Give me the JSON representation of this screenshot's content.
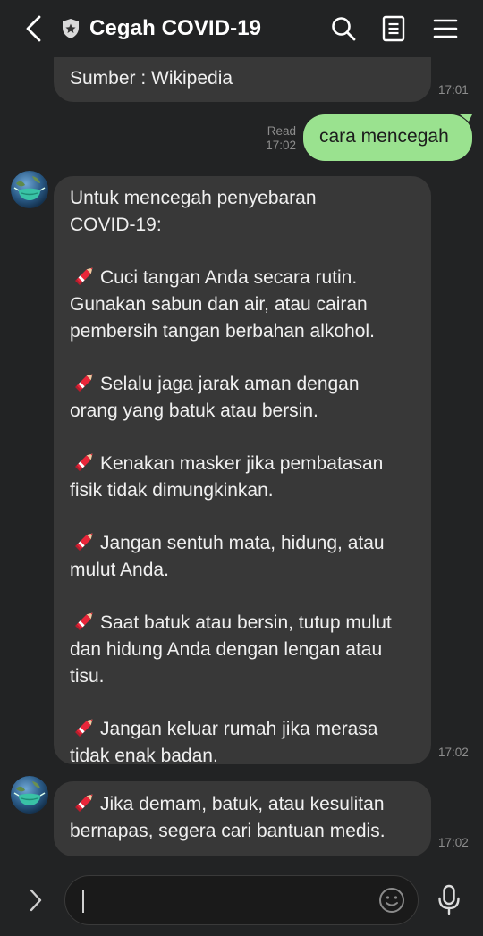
{
  "header": {
    "title": "Cegah COVID-19",
    "icons": [
      "back-chevron-icon",
      "shield-star-icon",
      "search-icon",
      "notes-icon",
      "menu-icon"
    ]
  },
  "messages": {
    "m1": {
      "text": "Sumber : Wikipedia",
      "time": "17:01"
    },
    "m2": {
      "text": "cara mencegah",
      "read_label": "Read",
      "time": "17:02"
    },
    "m3": {
      "intro_l1": "Untuk mencegah penyebaran",
      "intro_l2": "COVID-19:",
      "b1_l1": "Cuci tangan Anda secara rutin.",
      "b1_l2": "Gunakan sabun dan air, atau cairan",
      "b1_l3": "pembersih tangan berbahan alkohol.",
      "b2_l1": "Selalu jaga jarak aman dengan",
      "b2_l2": "orang yang batuk atau bersin.",
      "b3_l1": "Kenakan masker jika pembatasan",
      "b3_l2": "fisik tidak dimungkinkan.",
      "b4_l1": "Jangan sentuh mata, hidung, atau",
      "b4_l2": "mulut Anda.",
      "b5_l1": "Saat batuk atau bersin, tutup mulut",
      "b5_l2": "dan hidung Anda dengan lengan atau",
      "b5_l3": "tisu.",
      "b6_l1": "Jangan keluar rumah jika merasa",
      "b6_l2": "tidak enak badan.",
      "time": "17:02"
    },
    "m4": {
      "l1": "Jika demam, batuk, atau kesulitan",
      "l2": "bernapas, segera cari bantuan medis.",
      "time": "17:02"
    }
  },
  "bubble_colors": {
    "incoming": "#383838",
    "outgoing": "#9ae28f",
    "background": "#222324"
  },
  "input_bar": {
    "placeholder": "",
    "icons": [
      "expand-chevron-icon",
      "emoji-icon",
      "microphone-icon"
    ]
  }
}
